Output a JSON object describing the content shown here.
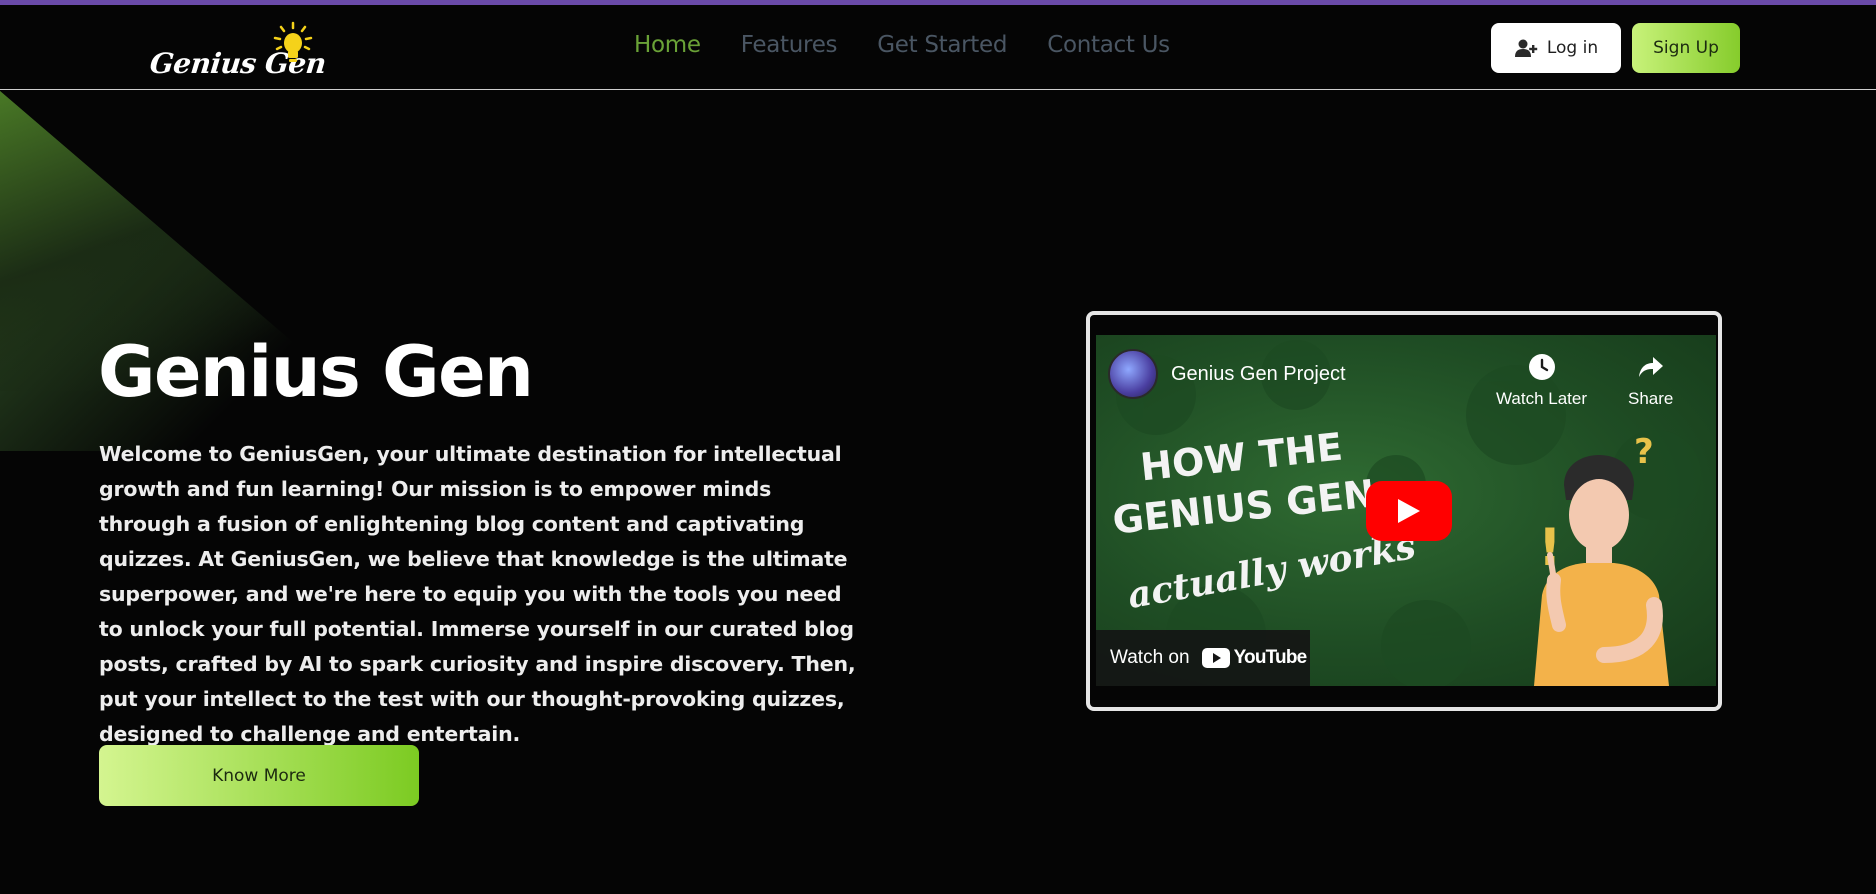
{
  "brand": {
    "name": "Genius Gen",
    "accent": "#86cc2c",
    "top_strip_color": "#6a4aa8"
  },
  "nav": {
    "items": [
      {
        "label": "Home",
        "active": true
      },
      {
        "label": "Features",
        "active": false
      },
      {
        "label": "Get Started",
        "active": false
      },
      {
        "label": "Contact Us",
        "active": false
      }
    ]
  },
  "auth": {
    "login_label": "Log in",
    "signup_label": "Sign Up",
    "login_icon": "user-plus-icon"
  },
  "hero": {
    "title": "Genius Gen",
    "description": "Welcome to GeniusGen, your ultimate destination for intellectual growth and fun learning! Our mission is to empower minds through a fusion of enlightening blog content and captivating quizzes. At GeniusGen, we believe that knowledge is the ultimate superpower, and we're here to equip you with the tools you need to unlock your full potential. Immerse yourself in our curated blog posts, crafted by AI to spark curiosity and inspire discovery. Then, put your intellect to the test with our thought-provoking quizzes, designed to challenge and entertain.",
    "cta_label": "Know More"
  },
  "video": {
    "title": "Genius Gen Project",
    "watch_later_label": "Watch Later",
    "share_label": "Share",
    "watch_on_label": "Watch on",
    "platform_label": "YouTube",
    "thumbnail_line1": "HOW THE",
    "thumbnail_line2": "GENIUS GEN",
    "thumbnail_line3": "actually works",
    "thumbnail_mark1": "!",
    "thumbnail_mark2": "?"
  }
}
